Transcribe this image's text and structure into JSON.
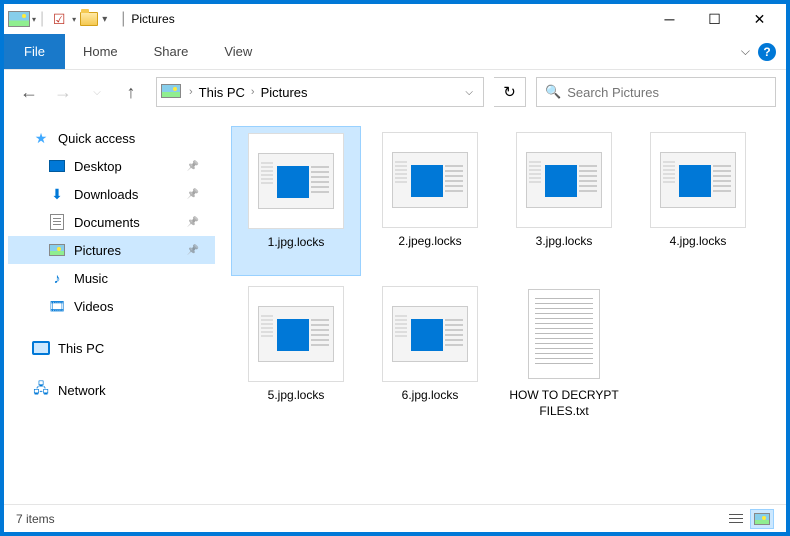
{
  "titlebar": {
    "title": "Pictures",
    "separator": "|"
  },
  "ribbon": {
    "file": "File",
    "tabs": [
      "Home",
      "Share",
      "View"
    ]
  },
  "nav": {
    "breadcrumbs": [
      "This PC",
      "Pictures"
    ],
    "refresh_glyph": "↻",
    "search_placeholder": "Search Pictures"
  },
  "sidebar": {
    "quick_access": "Quick access",
    "items": [
      {
        "label": "Desktop",
        "icon": "desktop",
        "pinned": true
      },
      {
        "label": "Downloads",
        "icon": "download",
        "pinned": true
      },
      {
        "label": "Documents",
        "icon": "doc",
        "pinned": true
      },
      {
        "label": "Pictures",
        "icon": "pic",
        "pinned": true,
        "selected": true
      },
      {
        "label": "Music",
        "icon": "music",
        "pinned": false
      },
      {
        "label": "Videos",
        "icon": "video",
        "pinned": false
      }
    ],
    "this_pc": "This PC",
    "network": "Network"
  },
  "files": [
    {
      "name": "1.jpg.locks",
      "type": "thumb",
      "selected": true
    },
    {
      "name": "2.jpeg.locks",
      "type": "thumb"
    },
    {
      "name": "3.jpg.locks",
      "type": "thumb"
    },
    {
      "name": "4.jpg.locks",
      "type": "thumb"
    },
    {
      "name": "5.jpg.locks",
      "type": "thumb"
    },
    {
      "name": "6.jpg.locks",
      "type": "thumb"
    },
    {
      "name": "HOW TO DECRYPT FILES.txt",
      "type": "txt"
    }
  ],
  "statusbar": {
    "count_text": "7 items"
  }
}
